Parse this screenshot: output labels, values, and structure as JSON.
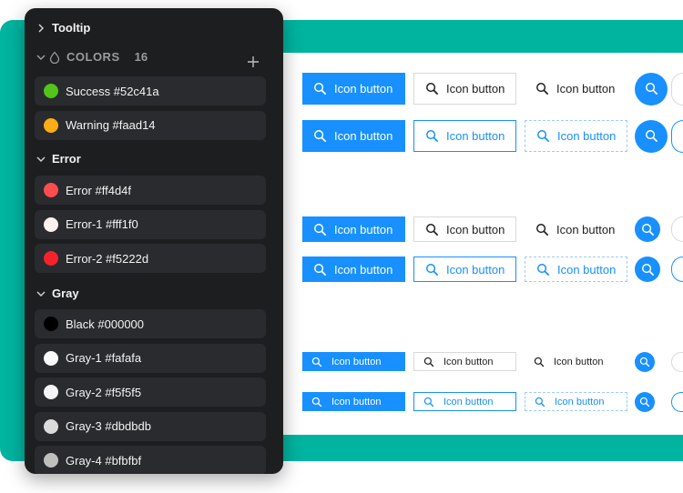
{
  "panel": {
    "tooltip_label": "Tooltip",
    "colors_label": "COLORS",
    "colors_count": "16",
    "groups": {
      "status": [
        {
          "label": "Success  #52c41a",
          "color": "#52c41a"
        },
        {
          "label": "Warning  #faad14",
          "color": "#faad14"
        }
      ],
      "error_label": "Error",
      "error": [
        {
          "label": "Error  #ff4d4f",
          "color": "#ff4d4f"
        },
        {
          "label": "Error-1  #fff1f0",
          "color": "#fff1f0"
        },
        {
          "label": "Error-2  #f5222d",
          "color": "#f5222d"
        }
      ],
      "gray_label": "Gray",
      "gray": [
        {
          "label": "Black  #000000",
          "color": "#000000"
        },
        {
          "label": "Gray-1  #fafafa",
          "color": "#fafafa"
        },
        {
          "label": "Gray-2  #f5f5f5",
          "color": "#f5f5f5"
        },
        {
          "label": "Gray-3  #dbdbdb",
          "color": "#dbdbdb"
        },
        {
          "label": "Gray-4  #bfbfbf",
          "color": "#bfbfbf"
        }
      ]
    }
  },
  "buttons": {
    "label": "Icon button"
  },
  "colors": {
    "teal": "#00b4a0",
    "primary": "#1890ff",
    "panel": "#1d1e20"
  }
}
